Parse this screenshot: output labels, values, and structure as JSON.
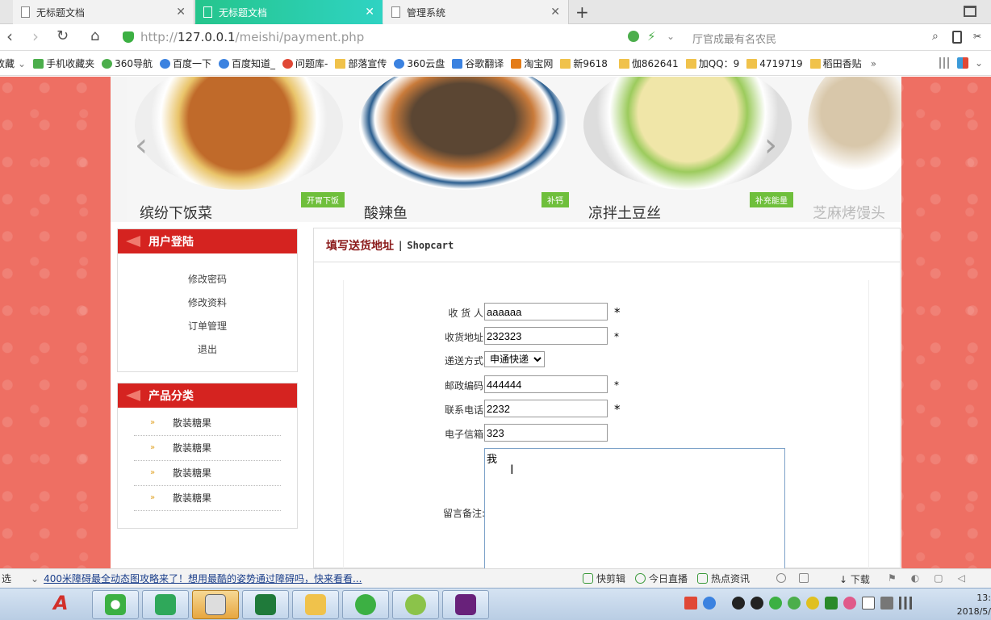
{
  "browser": {
    "tabs": [
      {
        "title": "无标题文档"
      },
      {
        "title": "无标题文档"
      },
      {
        "title": "管理系统"
      }
    ],
    "url_prefix": "http://",
    "url_host": "127.0.0.1",
    "url_path": "/meishi/payment.php",
    "search_placeholder": "厅官成最有名农民"
  },
  "bookmarks": [
    {
      "label": "收藏",
      "icon": "star-icon"
    },
    {
      "label": "手机收藏夹",
      "icon": "phone-icon"
    },
    {
      "label": "360导航",
      "icon": "360-icon"
    },
    {
      "label": "百度一下",
      "icon": "baidu-icon"
    },
    {
      "label": "百度知道_",
      "icon": "baidu-icon"
    },
    {
      "label": "问题库-",
      "icon": "sogou-icon"
    },
    {
      "label": "部落宣传",
      "icon": "folder-icon"
    },
    {
      "label": "360云盘",
      "icon": "cloud-icon"
    },
    {
      "label": "谷歌翻译",
      "icon": "translate-icon"
    },
    {
      "label": "淘宝网",
      "icon": "taobao-icon"
    },
    {
      "label": "新9618",
      "icon": "folder-icon"
    },
    {
      "label": "伽862641",
      "icon": "folder-icon"
    },
    {
      "label": "加QQ：9",
      "icon": "folder-icon"
    },
    {
      "label": "4719719",
      "icon": "folder-icon"
    },
    {
      "label": "稻田香贴",
      "icon": "folder-icon"
    }
  ],
  "bookmarks_more": "»",
  "banner": [
    {
      "name": "缤纷下饭菜",
      "tag": "开胃下饭"
    },
    {
      "name": "酸辣鱼",
      "tag": "补钙"
    },
    {
      "name": "凉拌土豆丝",
      "tag": "补充能量"
    },
    {
      "name": "芝麻烤馒头",
      "tag": ""
    }
  ],
  "sidebar": {
    "login_title": "用户登陆",
    "login_links": [
      "修改密码",
      "修改资料",
      "订单管理",
      "退出"
    ],
    "category_title": "产品分类",
    "categories": [
      "散装糖果",
      "散装糖果",
      "散装糖果",
      "散装糖果"
    ],
    "bullet": "»"
  },
  "main": {
    "title": "填写送货地址",
    "separator": "|",
    "subtitle": "Shopcart",
    "form": {
      "receiver_label": "收 货 人:",
      "receiver_value": "aaaaaa",
      "address_label": "收货地址:",
      "address_value": "232323",
      "delivery_label": "递送方式:",
      "delivery_value": "申通快递",
      "zip_label": "邮政编码:",
      "zip_value": "444444",
      "phone_label": "联系电话:",
      "phone_value": "2232",
      "email_label": "电子信箱:",
      "email_value": "323",
      "note_label": "留言备注:",
      "note_value": "我",
      "required_mark": "*"
    }
  },
  "statusbar": {
    "select_label": "选",
    "news": "400米障碍最全动态图攻略来了！想用最酷的姿势通过障碍吗，快来看看...",
    "items": [
      "快剪辑",
      "今日直播",
      "热点资讯"
    ],
    "download": "下载"
  },
  "taskbar": {
    "clock_time": "13:",
    "clock_date": "2018/5/"
  }
}
